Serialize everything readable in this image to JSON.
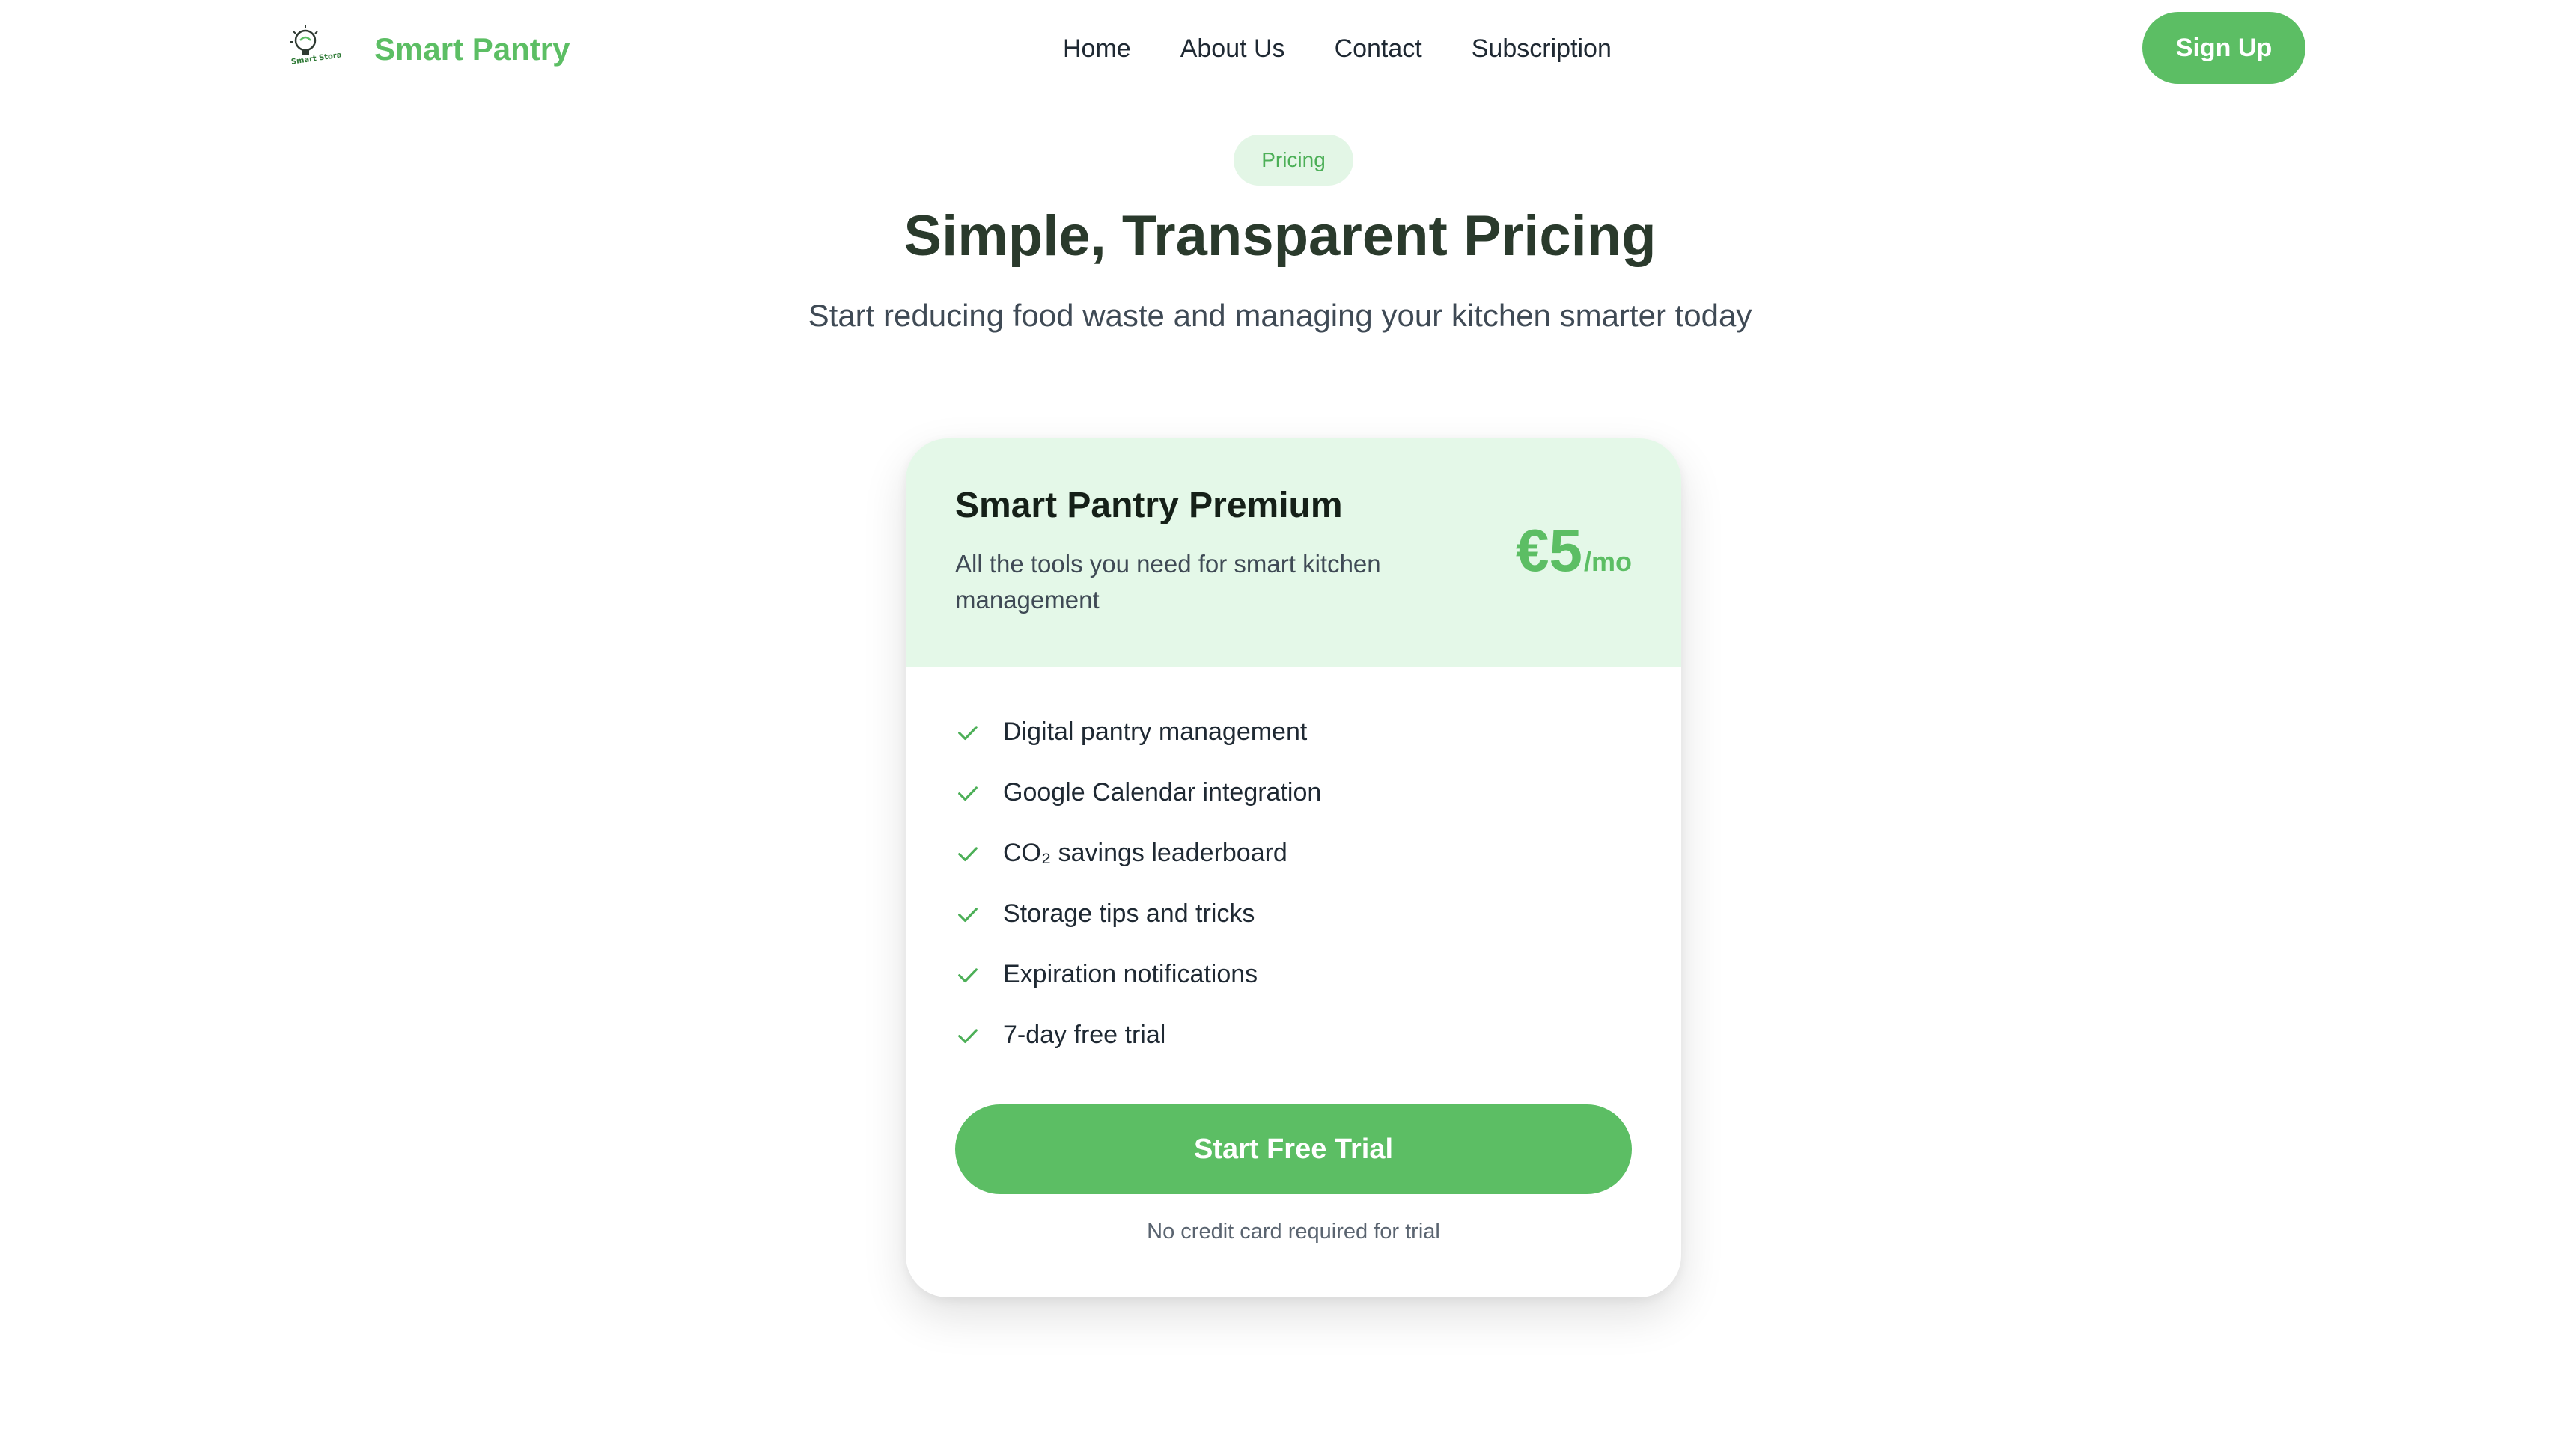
{
  "header": {
    "brand_name": "Smart Pantry",
    "logo_text": "Smart Storage",
    "nav": [
      {
        "label": "Home"
      },
      {
        "label": "About Us"
      },
      {
        "label": "Contact"
      },
      {
        "label": "Subscription"
      }
    ],
    "signup_label": "Sign Up"
  },
  "hero": {
    "badge": "Pricing",
    "title": "Simple, Transparent Pricing",
    "subtitle": "Start reducing food waste and managing your kitchen smarter today"
  },
  "plan": {
    "name": "Smart Pantry Premium",
    "description": "All the tools you need for smart kitchen management",
    "price": "€5",
    "period": "/mo",
    "features": [
      "Digital pantry management",
      "Google Calendar integration",
      "CO₂ savings leaderboard",
      "Storage tips and tricks",
      "Expiration notifications",
      "7-day free trial"
    ],
    "cta_label": "Start Free Trial",
    "note": "No credit card required for trial"
  },
  "colors": {
    "brand_green": "#5cbe64",
    "light_green": "#e4f8e8",
    "heading": "#2a3a2c"
  },
  "icons": {
    "feature": "check-icon",
    "logo": "lightbulb-logo-icon"
  }
}
